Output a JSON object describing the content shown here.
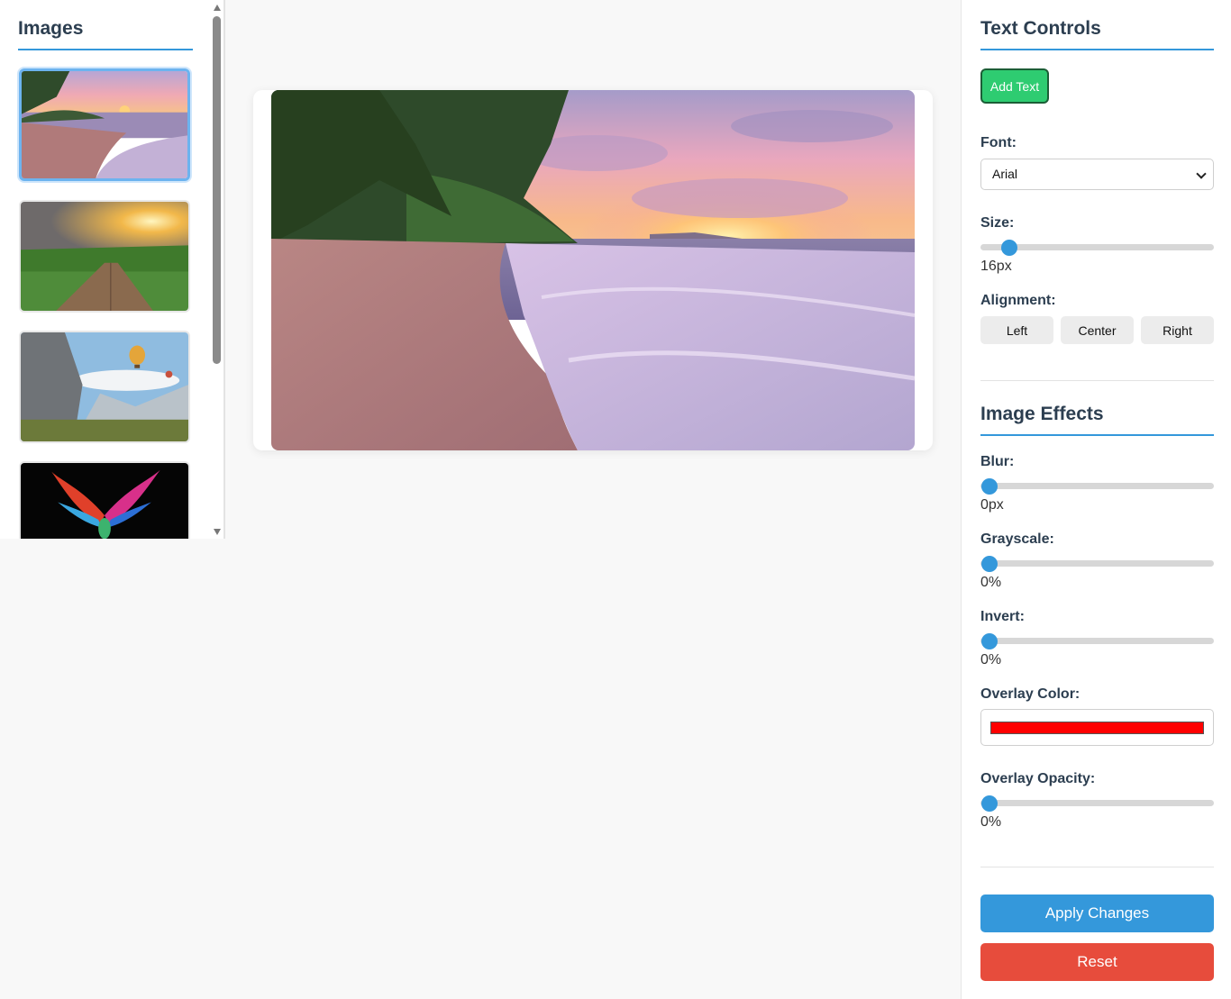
{
  "sidebar": {
    "title": "Images",
    "thumbnails": [
      {
        "name": "beach-sunset",
        "active": true
      },
      {
        "name": "boardwalk-sunrise",
        "active": false
      },
      {
        "name": "mountains-balloons",
        "active": false
      },
      {
        "name": "rainbow-eagle",
        "active": false
      }
    ]
  },
  "canvas": {
    "image": "beach-sunset"
  },
  "text_controls": {
    "title": "Text Controls",
    "add_text_label": "Add Text",
    "font_label": "Font:",
    "font_value": "Arial",
    "size_label": "Size:",
    "size_value": "16px",
    "size_level": 0.09,
    "alignment_label": "Alignment:",
    "align_left": "Left",
    "align_center": "Center",
    "align_right": "Right"
  },
  "image_effects": {
    "title": "Image Effects",
    "blur_label": "Blur:",
    "blur_value": "0px",
    "grayscale_label": "Grayscale:",
    "grayscale_value": "0%",
    "invert_label": "Invert:",
    "invert_value": "0%",
    "overlay_color_label": "Overlay Color:",
    "overlay_color": "#ff0000",
    "overlay_opacity_label": "Overlay Opacity:",
    "overlay_opacity_value": "0%"
  },
  "actions": {
    "apply_label": "Apply Changes",
    "reset_label": "Reset"
  },
  "colors": {
    "accent": "#3498db",
    "add_button": "#2ecc71",
    "reset_button": "#e74c3c"
  }
}
